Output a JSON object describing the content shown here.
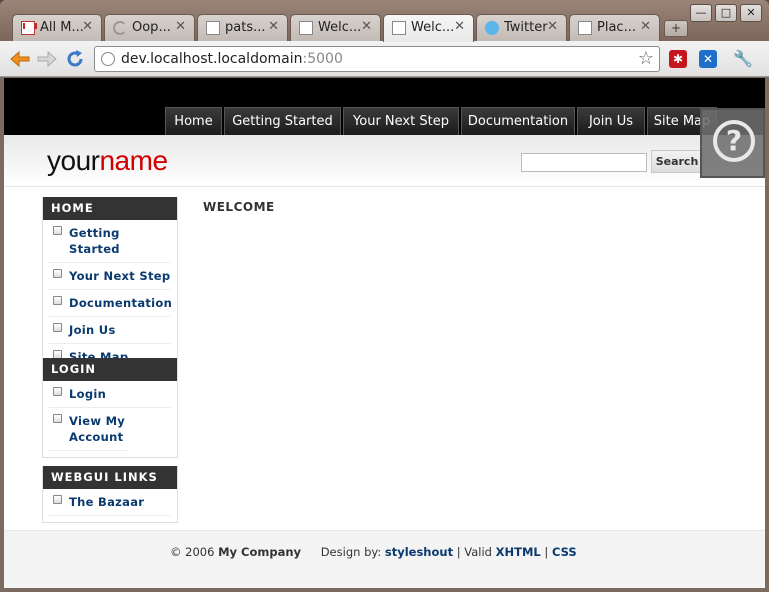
{
  "browser": {
    "tabs": [
      {
        "label": "All M...",
        "icon": "gmail-icon"
      },
      {
        "label": "Oop...",
        "icon": "moon-icon"
      },
      {
        "label": "pats...",
        "icon": "document-icon"
      },
      {
        "label": "Welc...",
        "icon": "document-icon"
      },
      {
        "label": "Welc...",
        "icon": "document-icon",
        "active": true
      },
      {
        "label": "Twitter",
        "icon": "twitter-icon"
      },
      {
        "label": "Plac...",
        "icon": "document-icon"
      }
    ],
    "new_tab": "+",
    "close_glyph": "✕",
    "url_host": "dev.localhost.localdomain",
    "url_port": ":5000",
    "window_controls": {
      "minimize": "—",
      "maximize": "□",
      "close": "✕"
    }
  },
  "site": {
    "menu": [
      "Home",
      "Getting Started",
      "Your Next Step",
      "Documentation",
      "Join Us",
      "Site Map"
    ],
    "logo": {
      "part1": "your",
      "part2": "name"
    },
    "search_button": "Search",
    "help_glyph": "?",
    "sidebar": [
      {
        "title": "HOME",
        "items": [
          "Getting Started",
          "Your Next Step",
          "Documentation",
          "Join Us",
          "Site Map"
        ]
      },
      {
        "title": "LOGIN",
        "items": [
          "Login",
          "View My Account"
        ]
      },
      {
        "title": "WEBGUI LINKS",
        "items": [
          "The Bazaar"
        ]
      }
    ],
    "main_title": "WELCOME",
    "footer": {
      "copyright": "© 2006",
      "company": "My Company",
      "design_by": "Design by:",
      "designer": "styleshout",
      "valid": "| Valid",
      "xhtml": "XHTML",
      "sep": "|",
      "css": "CSS"
    }
  },
  "colors": {
    "logo_accent": "#d10000",
    "link": "#0a3a6e",
    "menu_bg": "#1c1c1c"
  }
}
